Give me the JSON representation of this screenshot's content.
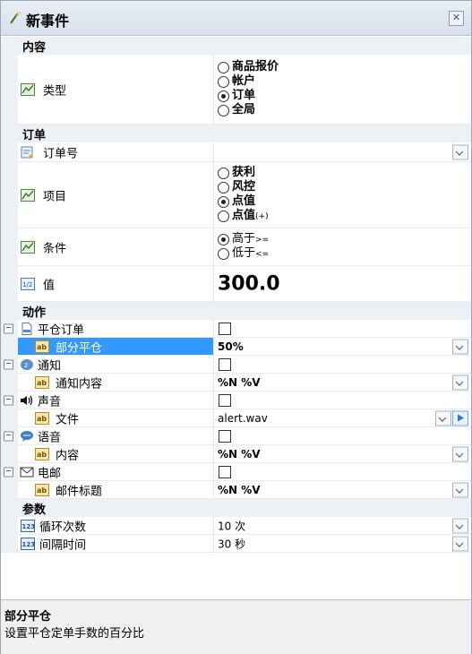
{
  "window": {
    "title": "新事件"
  },
  "sections": {
    "content": "内容",
    "order": "订单",
    "actions": "动作",
    "params": "参数"
  },
  "type_row": {
    "label": "类型",
    "options": [
      "商品报价",
      "帐户",
      "订单",
      "全局"
    ],
    "selected": "订单"
  },
  "order_no": {
    "label": "订单号",
    "value": ""
  },
  "item_row": {
    "label": "项目",
    "options": [
      "获利",
      "风控",
      "点值",
      "点值"
    ],
    "option_suffix": [
      "",
      "",
      "",
      "(+)"
    ],
    "selected": "点值"
  },
  "cond_row": {
    "label": "条件",
    "options": [
      "高于",
      "低于"
    ],
    "suffix": [
      ">=",
      "<="
    ],
    "selected": "高于"
  },
  "value_row": {
    "label": "值",
    "value": "300.0"
  },
  "close_order": {
    "label": "平仓订单",
    "checked": false
  },
  "partial_close": {
    "label": "部分平仓",
    "value": "50%"
  },
  "notify": {
    "label": "通知",
    "checked": false
  },
  "notify_content": {
    "label": "通知内容",
    "value": "%N %V"
  },
  "sound": {
    "label": "声音",
    "checked": false
  },
  "sound_file": {
    "label": "文件",
    "value": "alert.wav"
  },
  "voice": {
    "label": "语音",
    "checked": false
  },
  "voice_content": {
    "label": "内容",
    "value": "%N %V"
  },
  "email": {
    "label": "电邮",
    "checked": false
  },
  "email_subject": {
    "label": "邮件标题",
    "value": "%N %V"
  },
  "loop_count": {
    "label": "循环次数",
    "value": "10 次"
  },
  "interval": {
    "label": "间隔时间",
    "value": "30 秒"
  },
  "help": {
    "title": "部分平仓",
    "text": "设置平仓定单手数的百分比"
  },
  "colors": {
    "selection": "#3399ff",
    "category_bg": "#edf0f4"
  }
}
